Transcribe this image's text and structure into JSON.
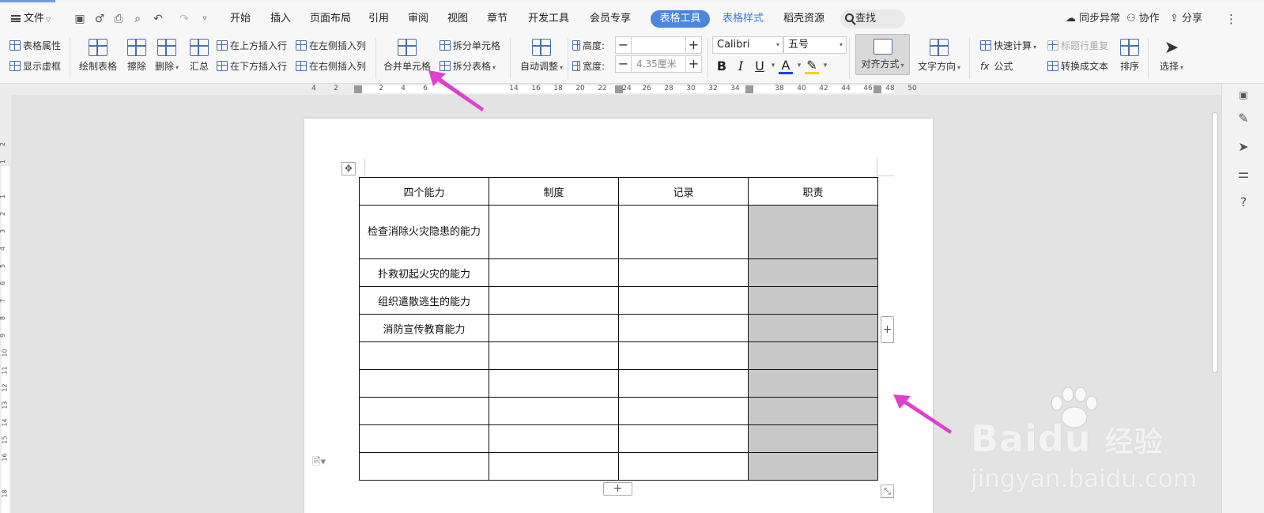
{
  "menubar": {
    "file_label": "文件",
    "tabs": [
      "开始",
      "插入",
      "页面布局",
      "引用",
      "审阅",
      "视图",
      "章节",
      "开发工具",
      "会员专享",
      "表格工具",
      "表格样式",
      "稻壳资源"
    ],
    "active_tab": "表格工具",
    "search_label": "查找",
    "right": [
      "同步异常",
      "协作",
      "分享"
    ]
  },
  "ribbon": {
    "table_props": "表格属性",
    "show_gridlines": "显示虚框",
    "draw_table": "绘制表格",
    "erase": "擦除",
    "delete": "删除",
    "summary": "汇总",
    "insert_above": "在上方插入行",
    "insert_below": "在下方插入行",
    "insert_left": "在左侧插入列",
    "insert_right": "在右侧插入列",
    "merge_cells": "合并单元格",
    "split_cells": "拆分单元格",
    "split_table": "拆分表格",
    "auto_fit": "自动调整",
    "height_label": "高度:",
    "height_value": "",
    "width_label": "宽度:",
    "width_value": "4.35厘米",
    "font_name": "Calibri",
    "font_size": "五号",
    "bold": "B",
    "italic": "I",
    "underline": "U",
    "font_color": "A",
    "alignment": "对齐方式",
    "text_direction": "文字方向",
    "quick_calc": "快速计算",
    "repeat_header": "标题行重复",
    "formula": "公式",
    "convert_text": "转换成文本",
    "sort": "排序",
    "select": "选择"
  },
  "ruler": {
    "ticks": [
      "4",
      "2",
      "2",
      "4",
      "6",
      "14",
      "16",
      "18",
      "20",
      "22",
      "24",
      "26",
      "28",
      "30",
      "32",
      "34",
      "38",
      "40",
      "42",
      "44",
      "46",
      "48",
      "50"
    ]
  },
  "vruler": {
    "ticks": [
      "2",
      "1",
      "1",
      "2",
      "3",
      "4",
      "5",
      "6",
      "7",
      "8",
      "9",
      "10",
      "11",
      "12",
      "13",
      "14",
      "15",
      "16",
      "18"
    ]
  },
  "table": {
    "headers": [
      "四个能力",
      "制度",
      "记录",
      "职责"
    ],
    "rows": [
      [
        "检查消除火灾隐患的能力",
        "",
        "",
        ""
      ],
      [
        "扑救初起火灾的能力",
        "",
        "",
        ""
      ],
      [
        "组织遣散逃生的能力",
        "",
        "",
        ""
      ],
      [
        "消防宣传教育能力",
        "",
        "",
        ""
      ],
      [
        "",
        "",
        "",
        ""
      ],
      [
        "",
        "",
        "",
        ""
      ],
      [
        "",
        "",
        "",
        ""
      ],
      [
        "",
        "",
        "",
        ""
      ],
      [
        "",
        "",
        "",
        ""
      ]
    ],
    "shade_color": "#c8c8c8"
  },
  "watermark": {
    "brand": "Bai",
    "brand_suffix": "du",
    "brand_cn": "经验",
    "site": "jingyan.baidu.com"
  },
  "colors": {
    "accent": "#4a87de",
    "arrow": "#e040d0"
  }
}
